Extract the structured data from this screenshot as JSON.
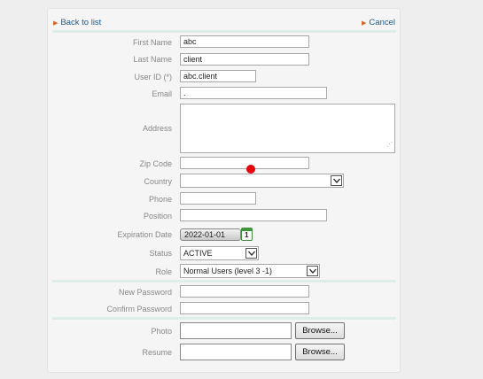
{
  "nav": {
    "back_label": "Back to list",
    "cancel_label": "Cancel",
    "arrow_glyph": "▶"
  },
  "form": {
    "first_name": {
      "label": "First Name",
      "value": "abc"
    },
    "last_name": {
      "label": "Last Name",
      "value": "client"
    },
    "user_id": {
      "label": "User ID (*)",
      "value": "abc.client"
    },
    "email": {
      "label": "Email",
      "value": "."
    },
    "address": {
      "label": "Address",
      "value": ""
    },
    "zip_code": {
      "label": "Zip Code",
      "value": ""
    },
    "country": {
      "label": "Country",
      "value": ""
    },
    "phone": {
      "label": "Phone",
      "value": ""
    },
    "position": {
      "label": "Position",
      "value": ""
    },
    "expiration_date": {
      "label": "Expiration Date",
      "value": "2022-01-01",
      "calendar_day": "1"
    },
    "status": {
      "label": "Status",
      "value": "ACTIVE"
    },
    "role": {
      "label": "Role",
      "value": "Normal Users (level 3 -1)"
    },
    "new_password": {
      "label": "New Password",
      "value": ""
    },
    "confirm_password": {
      "label": "Confirm Password",
      "value": ""
    },
    "photo": {
      "label": "Photo",
      "browse_label": "Browse..."
    },
    "resume": {
      "label": "Resume",
      "browse_label": "Browse..."
    }
  },
  "icons": {
    "back": "triangle-right-icon",
    "cancel": "triangle-right-icon",
    "calendar": "calendar-icon",
    "dropdown": "chevron-down-icon",
    "resize": "resize-grip-icon"
  },
  "colors": {
    "page_bg": "#eeeeee",
    "panel_bg": "#f5f5f5",
    "link": "#1c5a91",
    "link_arrow": "#d9652c",
    "label": "#888888",
    "separator": "#ddeee6",
    "calendar_green": "#3a9a3a",
    "cursor_marker": "#e8000b"
  }
}
